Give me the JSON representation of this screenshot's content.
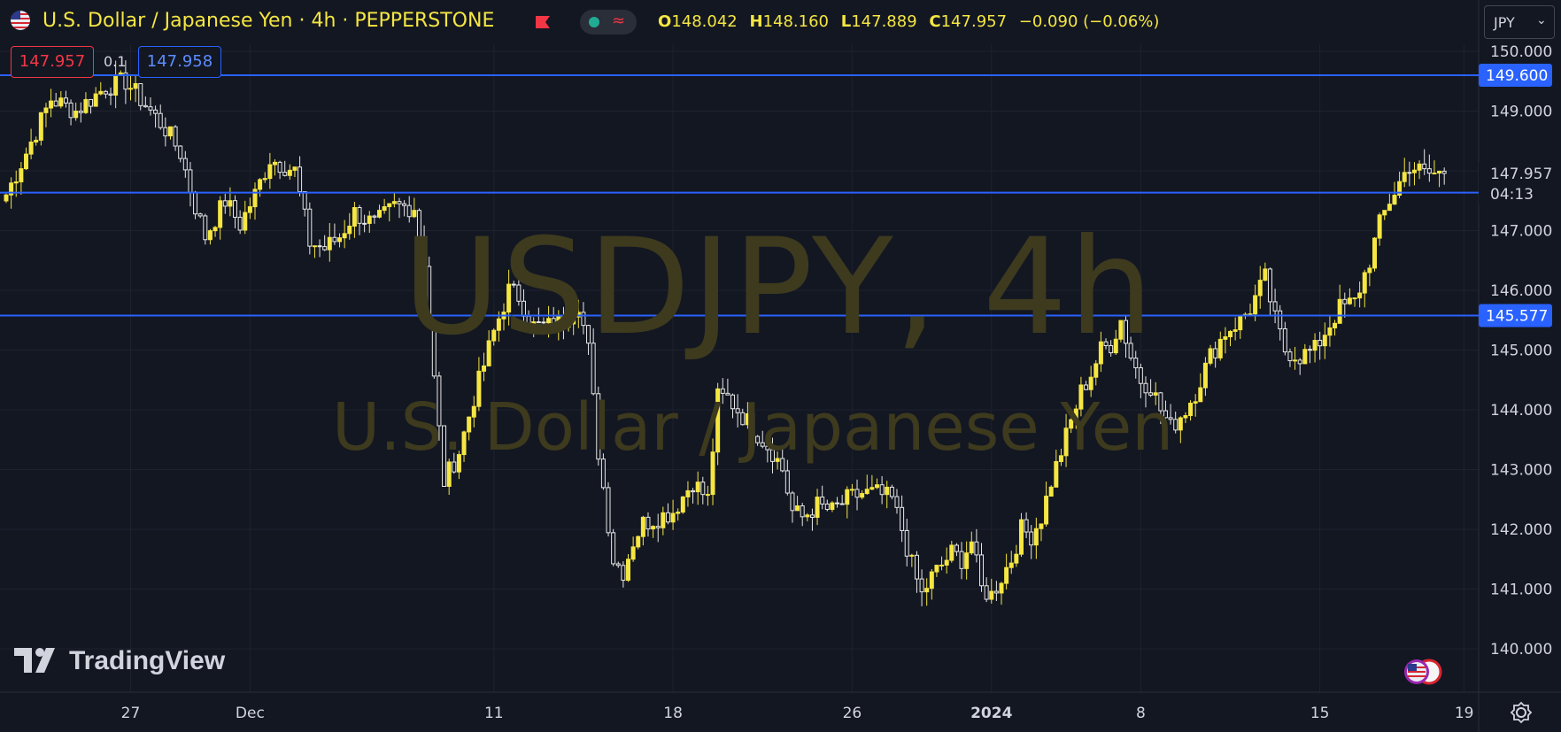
{
  "header": {
    "title": "U.S. Dollar / Japanese Yen · 4h · PEPPERSTONE",
    "ohlc": [
      {
        "k": "O",
        "v": "148.042"
      },
      {
        "k": "H",
        "v": "148.160"
      },
      {
        "k": "L",
        "v": "147.889"
      },
      {
        "k": "C",
        "v": "147.957"
      },
      {
        "k": "",
        "v": "−0.090 (−0.06%)"
      }
    ],
    "currency": "JPY",
    "sell": "147.957",
    "buy": "147.958",
    "spread": "0.1"
  },
  "watermark": {
    "line1": "USDJPY, 4h",
    "line2": "U.S. Dollar / Japanese Yen"
  },
  "logo": "TradingView",
  "countdown": "04:13",
  "colors": {
    "background": "#131722",
    "candle": "#f5e642",
    "hline": "#2962ff",
    "grid": "#1e222d"
  },
  "chart_data": {
    "type": "candlestick",
    "symbol": "USDJPY",
    "interval": "4h",
    "ylim": [
      139.6,
      150.3
    ],
    "y_ticks": [
      140,
      141,
      142,
      143,
      144,
      145,
      146,
      147,
      148,
      149,
      150
    ],
    "y_tick_labels": [
      "140.000",
      "141.000",
      "142.000",
      "143.000",
      "144.000",
      "145.000",
      "146.000",
      "147.000",
      "148.000",
      "149.000",
      "150.000"
    ],
    "x_ticks": [
      {
        "label": "27",
        "bar": 25
      },
      {
        "label": "Dec",
        "bar": 49
      },
      {
        "label": "11",
        "bar": 98
      },
      {
        "label": "18",
        "bar": 134
      },
      {
        "label": "26",
        "bar": 170
      },
      {
        "label": "2024",
        "bar": 198,
        "bold": true
      },
      {
        "label": "8",
        "bar": 228
      },
      {
        "label": "15",
        "bar": 264
      },
      {
        "label": "19",
        "bar": 293
      }
    ],
    "bar_count": 290,
    "horizontal_lines": [
      149.6,
      147.635,
      145.577
    ],
    "last_price": 147.957,
    "waypoints": [
      [
        0,
        147.6
      ],
      [
        4,
        148.3
      ],
      [
        9,
        149.2
      ],
      [
        14,
        149.0
      ],
      [
        20,
        149.4
      ],
      [
        24,
        149.5
      ],
      [
        28,
        149.1
      ],
      [
        32,
        148.7
      ],
      [
        35,
        148.3
      ],
      [
        38,
        147.4
      ],
      [
        40,
        146.9
      ],
      [
        44,
        147.5
      ],
      [
        47,
        147.1
      ],
      [
        50,
        147.6
      ],
      [
        53,
        148.2
      ],
      [
        58,
        148.0
      ],
      [
        61,
        146.8
      ],
      [
        64,
        146.7
      ],
      [
        67,
        146.9
      ],
      [
        70,
        147.3
      ],
      [
        74,
        147.1
      ],
      [
        78,
        147.4
      ],
      [
        82,
        147.4
      ],
      [
        84,
        146.5
      ],
      [
        86,
        144.5
      ],
      [
        88,
        142.8
      ],
      [
        91,
        143.3
      ],
      [
        94,
        144.2
      ],
      [
        98,
        145.3
      ],
      [
        101,
        146.0
      ],
      [
        103,
        145.9
      ],
      [
        106,
        145.4
      ],
      [
        109,
        145.4
      ],
      [
        112,
        145.5
      ],
      [
        115,
        145.8
      ],
      [
        117,
        145.0
      ],
      [
        119,
        143.3
      ],
      [
        122,
        141.5
      ],
      [
        124,
        141.3
      ],
      [
        126,
        141.8
      ],
      [
        128,
        142.1
      ],
      [
        131,
        142.2
      ],
      [
        134,
        142.3
      ],
      [
        138,
        142.8
      ],
      [
        141,
        142.5
      ],
      [
        143,
        144.2
      ],
      [
        145,
        144.2
      ],
      [
        148,
        143.9
      ],
      [
        151,
        143.6
      ],
      [
        154,
        143.3
      ],
      [
        156,
        143.0
      ],
      [
        158,
        142.3
      ],
      [
        160,
        142.2
      ],
      [
        163,
        142.4
      ],
      [
        166,
        142.3
      ],
      [
        169,
        142.5
      ],
      [
        172,
        142.6
      ],
      [
        175,
        142.6
      ],
      [
        178,
        142.5
      ],
      [
        180,
        142.0
      ],
      [
        182,
        141.4
      ],
      [
        184,
        140.9
      ],
      [
        186,
        141.2
      ],
      [
        188,
        141.4
      ],
      [
        190,
        141.6
      ],
      [
        192,
        141.5
      ],
      [
        194,
        141.8
      ],
      [
        196,
        141.0
      ],
      [
        198,
        140.9
      ],
      [
        200,
        141.2
      ],
      [
        202,
        141.5
      ],
      [
        204,
        142.0
      ],
      [
        206,
        141.9
      ],
      [
        208,
        142.2
      ],
      [
        210,
        142.8
      ],
      [
        212,
        143.3
      ],
      [
        214,
        143.8
      ],
      [
        216,
        144.3
      ],
      [
        218,
        144.6
      ],
      [
        220,
        145.0
      ],
      [
        222,
        145.1
      ],
      [
        224,
        145.5
      ],
      [
        226,
        144.9
      ],
      [
        228,
        144.5
      ],
      [
        230,
        144.4
      ],
      [
        232,
        144.0
      ],
      [
        234,
        143.7
      ],
      [
        237,
        144.0
      ],
      [
        239,
        144.3
      ],
      [
        242,
        144.9
      ],
      [
        245,
        145.3
      ],
      [
        248,
        145.5
      ],
      [
        250,
        145.7
      ],
      [
        253,
        146.2
      ],
      [
        255,
        145.5
      ],
      [
        257,
        145.0
      ],
      [
        260,
        144.9
      ],
      [
        263,
        145.0
      ],
      [
        265,
        145.3
      ],
      [
        268,
        145.7
      ],
      [
        271,
        145.8
      ],
      [
        274,
        146.5
      ],
      [
        276,
        147.1
      ],
      [
        278,
        147.5
      ],
      [
        280,
        147.8
      ],
      [
        282,
        148.1
      ],
      [
        285,
        147.95
      ],
      [
        289,
        147.957
      ]
    ]
  }
}
